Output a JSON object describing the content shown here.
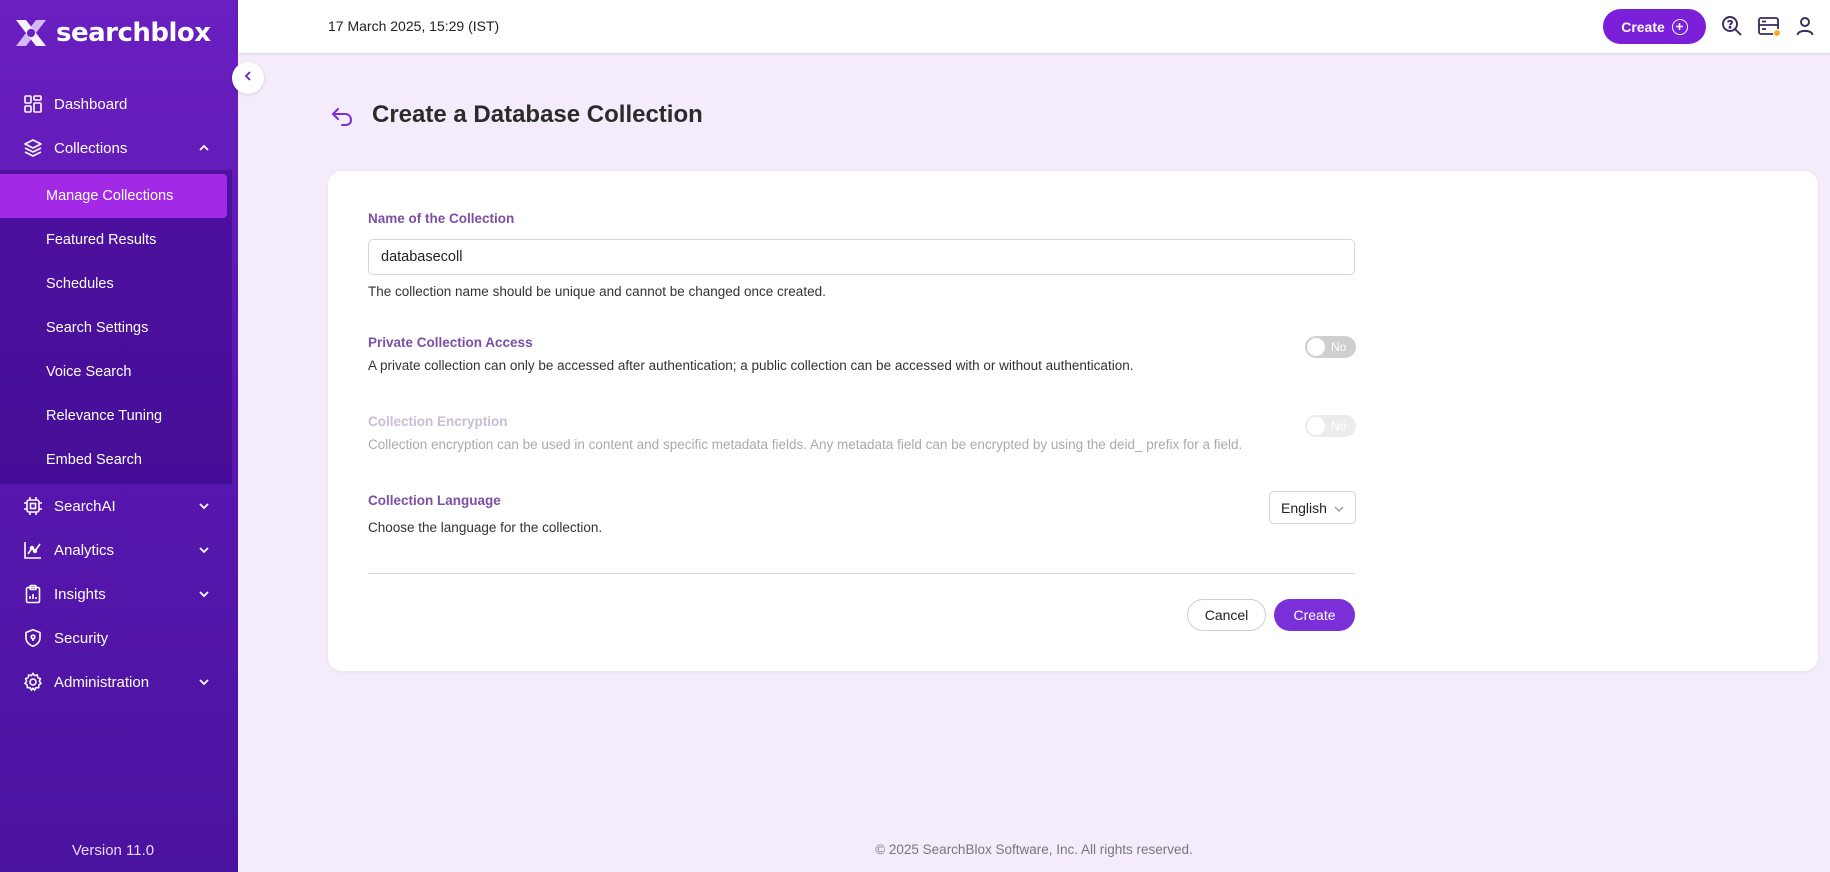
{
  "app": {
    "brand": "searchblox",
    "version": "Version 11.0"
  },
  "header": {
    "datetime": "17 March 2025, 15:29 (IST)",
    "create_label": "Create"
  },
  "sidebar": {
    "items": [
      {
        "label": "Dashboard",
        "icon": "dashboard-icon"
      },
      {
        "label": "Collections",
        "icon": "layers-icon",
        "expanded": true
      },
      {
        "label": "SearchAI",
        "icon": "chip-icon"
      },
      {
        "label": "Analytics",
        "icon": "analytics-icon"
      },
      {
        "label": "Insights",
        "icon": "clipboard-icon"
      },
      {
        "label": "Security",
        "icon": "shield-icon"
      },
      {
        "label": "Administration",
        "icon": "gear-icon"
      }
    ],
    "collections_sub": [
      "Manage Collections",
      "Featured Results",
      "Schedules",
      "Search Settings",
      "Voice Search",
      "Relevance Tuning",
      "Embed Search"
    ]
  },
  "page": {
    "title": "Create a Database Collection"
  },
  "form": {
    "name": {
      "label": "Name of the Collection",
      "value": "databasecoll",
      "help": "The collection name should be unique and cannot be changed once created."
    },
    "private": {
      "label": "Private Collection Access",
      "toggle": "No",
      "help": "A private collection can only be accessed after authentication; a public collection can be accessed with or without authentication."
    },
    "encryption": {
      "label": "Collection Encryption",
      "toggle": "No",
      "help": "Collection encryption can be used in content and specific metadata fields. Any metadata field can be encrypted by using the deid_ prefix for a field."
    },
    "language": {
      "label": "Collection Language",
      "selected": "English",
      "help": "Choose the language for the collection."
    },
    "cancel_label": "Cancel",
    "create_label": "Create"
  },
  "footer": {
    "text": "© 2025 SearchBlox Software, Inc. All rights reserved."
  },
  "colors": {
    "primary": "#7b1fd8",
    "sidebar": "#5a17b2",
    "active_item": "#a229e6",
    "label": "#7c4fa6"
  }
}
